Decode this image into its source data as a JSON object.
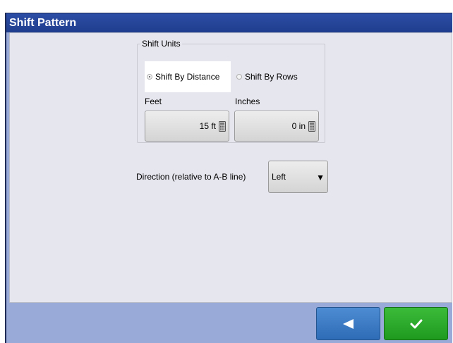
{
  "window": {
    "title": "Shift Pattern"
  },
  "shift_units": {
    "legend": "Shift Units",
    "options": [
      {
        "label": "Shift By Distance",
        "selected": true
      },
      {
        "label": "Shift By Rows",
        "selected": false
      }
    ],
    "feet": {
      "label": "Feet",
      "value": "15 ft"
    },
    "inches": {
      "label": "Inches",
      "value": "0 in"
    }
  },
  "direction": {
    "label": "Direction (relative to A-B line)",
    "selected": "Left"
  },
  "buttons": {
    "back_icon": "left-arrow-icon",
    "ok_icon": "checkmark-icon"
  },
  "colors": {
    "titlebar": "#1f3d8d",
    "back_button": "#2f6cb7",
    "ok_button": "#1f9a1f",
    "footer": "#9aaad8"
  }
}
